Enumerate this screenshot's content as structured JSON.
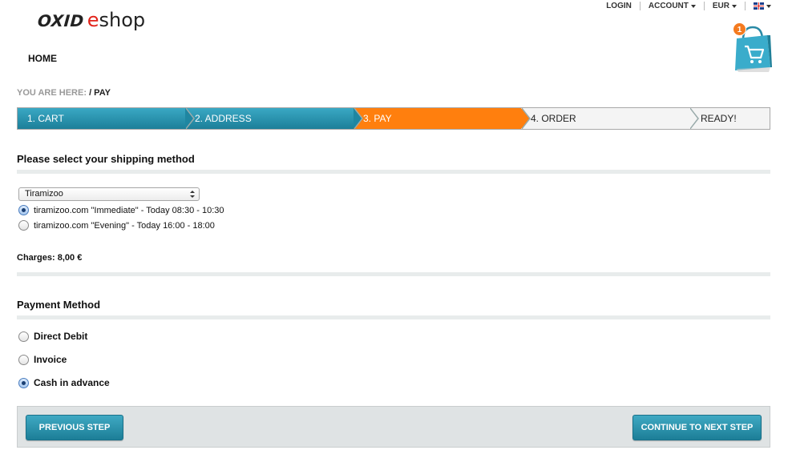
{
  "header": {
    "logo_oxid": "OXID",
    "logo_e": "e",
    "logo_shop": "shop",
    "nav": {
      "login": "LOGIN",
      "account": "ACCOUNT",
      "currency": "EUR"
    },
    "basket_count": "1",
    "home": "HOME"
  },
  "breadcrumb": {
    "prefix": "YOU ARE HERE:",
    "current": "/ PAY"
  },
  "steps": [
    {
      "label": "1. CART"
    },
    {
      "label": "2. ADDRESS"
    },
    {
      "label": "3. PAY"
    },
    {
      "label": "4. ORDER"
    },
    {
      "label": "READY!"
    }
  ],
  "shipping": {
    "title": "Please select your shipping method",
    "selected": "Tiramizoo",
    "options": [
      {
        "label": "tiramizoo.com \"Immediate\" - Today 08:30 - 10:30",
        "checked": true
      },
      {
        "label": "tiramizoo.com \"Evening\" - Today 16:00 - 18:00",
        "checked": false
      }
    ],
    "charges": "Charges: 8,00 €"
  },
  "payment": {
    "title": "Payment Method",
    "options": [
      {
        "label": "Direct Debit",
        "checked": false
      },
      {
        "label": "Invoice",
        "checked": false
      },
      {
        "label": "Cash in advance",
        "checked": true
      }
    ]
  },
  "actions": {
    "previous": "PREVIOUS STEP",
    "next": "CONTINUE TO NEXT STEP"
  },
  "colors": {
    "accent_teal": "#1c7f99",
    "active_step": "#ff7f0e",
    "basket_badge": "#f47a1f",
    "logo_red": "#e2231a"
  },
  "icons": {
    "basket": "shopping-bag-cart-icon",
    "language": "uk-flag-icon"
  }
}
